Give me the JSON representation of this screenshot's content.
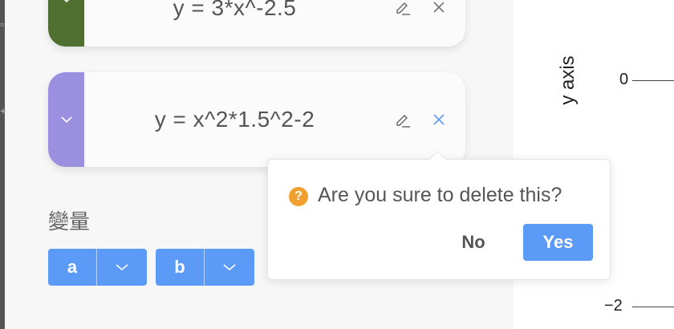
{
  "equations": [
    {
      "formula": "y = 3*x^-2.5",
      "color": "#4f7031",
      "toggle_icon": "chevron-down-icon",
      "edit_icon": "pencil-icon",
      "delete_icon": "close-icon"
    },
    {
      "formula": "y = x^2*1.5^2-2",
      "color": "#9b8fe0",
      "toggle_icon": "chevron-down-icon",
      "edit_icon": "pencil-icon",
      "delete_icon": "close-icon"
    }
  ],
  "variables": {
    "label": "變量",
    "items": [
      {
        "name": "a"
      },
      {
        "name": "b"
      }
    ],
    "accent": "#5b9bf7"
  },
  "graph": {
    "y_axis_label": "y axis",
    "ticks": [
      "0",
      "−2"
    ]
  },
  "confirm": {
    "icon": "question-icon",
    "message": "Are you sure to delete this?",
    "no_label": "No",
    "yes_label": "Yes",
    "yes_color": "#5b9bf7",
    "warn_color": "#f0a02f"
  }
}
